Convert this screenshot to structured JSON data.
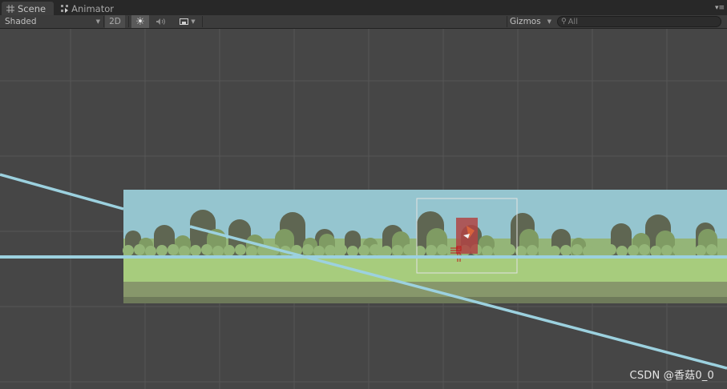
{
  "tabs": [
    {
      "label": "Scene",
      "icon": "grid-icon",
      "active": true
    },
    {
      "label": "Animator",
      "icon": "animator-icon",
      "active": false
    }
  ],
  "toolbar": {
    "shading_mode": "Shaded",
    "mode_2d_label": "2D",
    "lighting_icon": "sun-icon",
    "audio_icon": "speaker-icon",
    "effects_icon": "image-icon",
    "gizmos_label": "Gizmos",
    "search_placeholder": "All"
  },
  "colors": {
    "sky": "#95c5cf",
    "grass_light": "#a7cc7d",
    "grass_dark": "#87976b",
    "tree_dark": "#5f6652",
    "tree_mid": "#7f9b63",
    "tree_light": "#94b578",
    "collider_line": "#9cd1df",
    "selection_outline": "#e2e2e2",
    "player_collider": "#b04444"
  },
  "watermark": "CSDN @香菇0_0"
}
